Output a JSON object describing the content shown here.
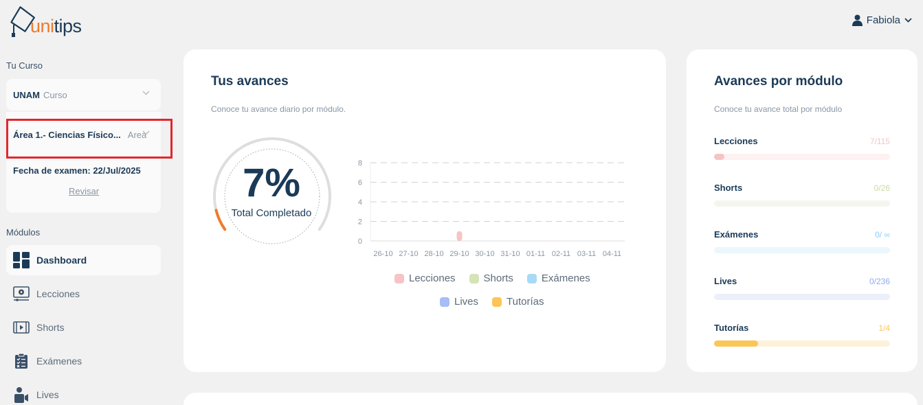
{
  "header": {
    "logo_text_accent": "uni",
    "logo_text_main": "tips",
    "user_name": "Fabiola"
  },
  "sidebar": {
    "course_section_label": "Tu Curso",
    "course_select": {
      "value": "UNAM",
      "sub": "Curso"
    },
    "area_select": {
      "value": "Área 1.- Ciencias Físico...",
      "sub": "Area"
    },
    "exam_date": "Fecha de examen: 22/Jul/2025",
    "review_link": "Revisar",
    "modules_label": "Módulos",
    "nav": [
      {
        "label": "Dashboard",
        "icon": "dashboard-icon",
        "active": true
      },
      {
        "label": "Lecciones",
        "icon": "lessons-icon"
      },
      {
        "label": "Shorts",
        "icon": "shorts-icon"
      },
      {
        "label": "Exámenes",
        "icon": "exams-icon"
      },
      {
        "label": "Lives",
        "icon": "lives-icon"
      }
    ]
  },
  "progress_card": {
    "title": "Tus avances",
    "subtitle": "Conoce tu avance diario por módulo.",
    "total_percent": "7%",
    "total_label": "Total Completado",
    "total_value": 0.07
  },
  "chart_data": {
    "type": "bar",
    "categories": [
      "26-10",
      "27-10",
      "28-10",
      "29-10",
      "30-10",
      "31-10",
      "01-11",
      "02-11",
      "03-11",
      "04-11"
    ],
    "series": [
      {
        "name": "Lecciones",
        "color": "#f6c4c4",
        "values": [
          0,
          0,
          0,
          1,
          0,
          0,
          0,
          0,
          0,
          0
        ]
      },
      {
        "name": "Shorts",
        "color": "#d5e3b7",
        "values": [
          0,
          0,
          0,
          0,
          0,
          0,
          0,
          0,
          0,
          0
        ]
      },
      {
        "name": "Exámenes",
        "color": "#a8daf7",
        "values": [
          0,
          0,
          0,
          0,
          0,
          0,
          0,
          0,
          0,
          0
        ]
      },
      {
        "name": "Lives",
        "color": "#a6bdf6",
        "values": [
          0,
          0,
          0,
          0,
          0,
          0,
          0,
          0,
          0,
          0
        ]
      },
      {
        "name": "Tutorías",
        "color": "#fbc658",
        "values": [
          0,
          0,
          0,
          0,
          0,
          0,
          0,
          0,
          0,
          0
        ]
      }
    ],
    "yticks": [
      0,
      2,
      4,
      6,
      8
    ],
    "ylim": [
      0,
      8
    ],
    "grid": true,
    "legend": "bottom"
  },
  "module_card": {
    "title": "Avances por módulo",
    "subtitle": "Conoce tu avance total por módulo",
    "modules": [
      {
        "label": "Lecciones",
        "value": "7/115",
        "fraction": 0.06,
        "color": "#f6c4c4",
        "track": "#fdf1f1"
      },
      {
        "label": "Shorts",
        "value": "0/26",
        "fraction": 0,
        "color": "#c9dba3",
        "track": "#f4f6ee"
      },
      {
        "label": "Exámenes",
        "value": "0/ ∞",
        "fraction": 0,
        "color": "#8ecdf5",
        "track": "#ecf6fd"
      },
      {
        "label": "Lives",
        "value": "0/236",
        "fraction": 0,
        "color": "#8eaaf0",
        "track": "#ebf0fb"
      },
      {
        "label": "Tutorías",
        "value": "1/4",
        "fraction": 0.25,
        "color": "#fbc658",
        "track": "#fdf2d9"
      }
    ]
  }
}
